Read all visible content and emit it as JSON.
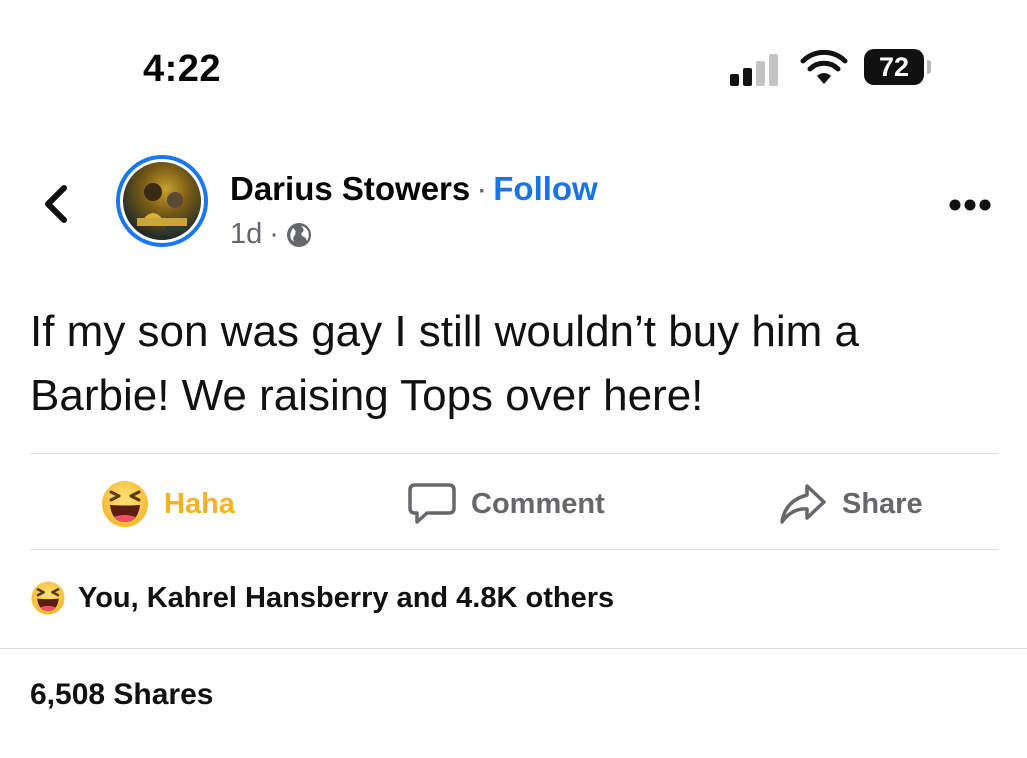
{
  "status_bar": {
    "time": "4:22",
    "battery": "72",
    "signal_bars_active": 2,
    "signal_bars_total": 4
  },
  "post": {
    "author": "Darius Stowers",
    "separator": "·",
    "follow_label": "Follow",
    "age": "1d",
    "meta_separator": "·",
    "privacy_icon": "globe-icon",
    "text": "If my son was gay I still wouldn’t buy him a Barbie! We raising Tops over here!"
  },
  "actions": {
    "reaction_label": "Haha",
    "comment_label": "Comment",
    "share_label": "Share"
  },
  "reactions_summary": {
    "text": "You, Kahrel Hansberry and 4.8K others",
    "icon": "haha-emoji-icon"
  },
  "shares_count": "6,508 Shares",
  "colors": {
    "accent": "#1b74e4",
    "haha": "#f7b125",
    "muted": "#65676b"
  }
}
